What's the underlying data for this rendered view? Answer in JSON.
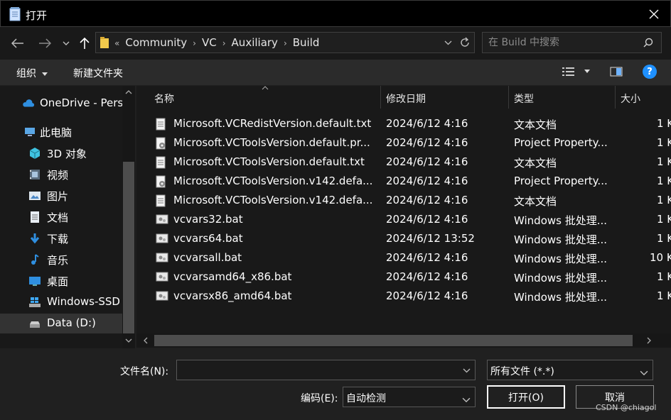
{
  "window": {
    "title": "打开",
    "title_icon": "notepad-icon",
    "close_icon": "close-icon"
  },
  "nav": {
    "back_icon": "back-arrow-icon",
    "forward_icon": "forward-arrow-icon",
    "history_icon": "chevron-down-icon",
    "up_icon": "up-arrow-icon"
  },
  "address": {
    "folder_icon": "folder-icon",
    "overflow": "«",
    "crumbs": [
      "Community",
      "VC",
      "Auxiliary",
      "Build"
    ],
    "dropdown_icon": "chevron-down-icon",
    "refresh_icon": "refresh-icon"
  },
  "search": {
    "placeholder": "在 Build 中搜索",
    "icon": "search-icon"
  },
  "toolbar": {
    "organize": "组织",
    "new_folder": "新建文件夹",
    "view_icon": "details-view-icon",
    "preview_icon": "preview-pane-icon",
    "help": "?"
  },
  "sidebar": {
    "items": [
      {
        "label": "OneDrive - Pers",
        "icon": "cloud-icon"
      },
      {
        "label": "此电脑",
        "icon": "computer-icon"
      },
      {
        "label": "3D 对象",
        "icon": "cube-icon"
      },
      {
        "label": "视频",
        "icon": "video-icon"
      },
      {
        "label": "图片",
        "icon": "picture-icon"
      },
      {
        "label": "文档",
        "icon": "document-icon"
      },
      {
        "label": "下载",
        "icon": "download-icon"
      },
      {
        "label": "音乐",
        "icon": "music-icon"
      },
      {
        "label": "桌面",
        "icon": "desktop-icon"
      },
      {
        "label": "Windows-SSD",
        "icon": "windows-drive-icon"
      },
      {
        "label": "Data (D:)",
        "icon": "drive-icon"
      }
    ],
    "selected_index": 10
  },
  "columns": {
    "name": "名称",
    "modified": "修改日期",
    "type": "类型",
    "size": "大小"
  },
  "files": [
    {
      "name": "Microsoft.VCRedistVersion.default.txt",
      "modified": "2024/6/12 4:16",
      "type": "文本文档",
      "size": "1 K",
      "icon": "text-file-icon"
    },
    {
      "name": "Microsoft.VCToolsVersion.default.pr...",
      "modified": "2024/6/12 4:16",
      "type": "Project Property...",
      "size": "1 K",
      "icon": "props-file-icon"
    },
    {
      "name": "Microsoft.VCToolsVersion.default.txt",
      "modified": "2024/6/12 4:16",
      "type": "文本文档",
      "size": "1 K",
      "icon": "text-file-icon"
    },
    {
      "name": "Microsoft.VCToolsVersion.v142.defa...",
      "modified": "2024/6/12 4:16",
      "type": "Project Property...",
      "size": "1 K",
      "icon": "props-file-icon"
    },
    {
      "name": "Microsoft.VCToolsVersion.v142.defa...",
      "modified": "2024/6/12 4:16",
      "type": "文本文档",
      "size": "1 K",
      "icon": "text-file-icon"
    },
    {
      "name": "vcvars32.bat",
      "modified": "2024/6/12 4:16",
      "type": "Windows 批处理...",
      "size": "1 K",
      "icon": "batch-file-icon"
    },
    {
      "name": "vcvars64.bat",
      "modified": "2024/6/12 13:52",
      "type": "Windows 批处理...",
      "size": "1 K",
      "icon": "batch-file-icon"
    },
    {
      "name": "vcvarsall.bat",
      "modified": "2024/6/12 4:16",
      "type": "Windows 批处理...",
      "size": "10 K",
      "icon": "batch-file-icon"
    },
    {
      "name": "vcvarsamd64_x86.bat",
      "modified": "2024/6/12 4:16",
      "type": "Windows 批处理...",
      "size": "1 K",
      "icon": "batch-file-icon"
    },
    {
      "name": "vcvarsx86_amd64.bat",
      "modified": "2024/6/12 4:16",
      "type": "Windows 批处理...",
      "size": "1 K",
      "icon": "batch-file-icon"
    }
  ],
  "footer": {
    "filename_label": "文件名(N):",
    "filename_value": "",
    "filter_value": "所有文件 (*.*)",
    "encoding_label": "编码(E):",
    "encoding_value": "自动检测",
    "open_button": "打开(O)",
    "cancel_button": "取消"
  },
  "watermark": "CSDN @chiagol",
  "colors": {
    "accent_help": "#1e90ff",
    "bg": "#191919",
    "titlebar": "#000000"
  }
}
